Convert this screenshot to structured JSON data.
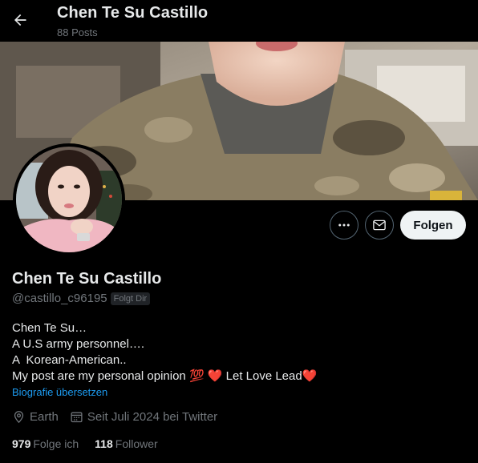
{
  "header": {
    "title": "Chen Te Su Castillo",
    "posts_count": "88 Posts"
  },
  "actions": {
    "follow_label": "Folgen"
  },
  "profile": {
    "display_name": "Chen Te Su Castillo",
    "handle": "@castillo_c96195",
    "follows_you_badge": "Folgt Dir",
    "bio_lines": [
      "Chen Te Su…",
      "A U.S army personnel….",
      "A  Korean-American..",
      "My post are my personal opinion 💯 ❤️ Let Love Lead❤️"
    ],
    "translate_label": "Biografie übersetzen",
    "location": "Earth",
    "joined": "Seit Juli 2024 bei Twitter"
  },
  "stats": {
    "following_count": "979",
    "following_label": "Folge ich",
    "followers_count": "118",
    "followers_label": "Follower"
  },
  "colors": {
    "background": "#000000",
    "text": "#e7e9ea",
    "muted": "#71767b",
    "link": "#1d9bf0",
    "follow_button_bg": "#eff3f4"
  }
}
